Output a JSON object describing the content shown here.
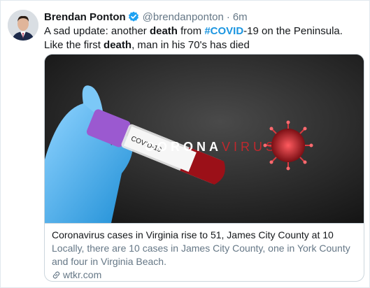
{
  "tweet": {
    "author_name": "Brendan Ponton",
    "author_handle": "@brendanponton",
    "separator": "·",
    "time": "6m",
    "text": {
      "p1": "A sad update: another ",
      "b1": "death",
      "p2": " from ",
      "tag": "#COVID",
      "p3": "-19 on the Peninsula. Like the first ",
      "b2": "death",
      "p4": ", man in his 70's has died"
    }
  },
  "card": {
    "image": {
      "headline_part1": "CORONA",
      "headline_part2": "VIRUS",
      "tube_label": "COVID-19"
    },
    "title": "Coronavirus cases in Virginia rise to 51, James City County at 10",
    "description": "Locally, there are 10 cases in James City County, one in York County and four in Virginia Beach.",
    "domain": "wtkr.com"
  },
  "colors": {
    "link_blue": "#1b95e0",
    "verified_blue": "#1da1f2",
    "secondary_text": "#657786",
    "virus_red": "#c0282d"
  },
  "icons": [
    "verified-badge-icon",
    "link-icon"
  ]
}
